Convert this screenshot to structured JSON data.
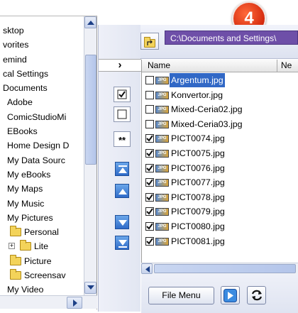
{
  "badge": {
    "number": "4"
  },
  "tree": {
    "items": [
      {
        "label": "sktop",
        "indent": 0,
        "folder": false
      },
      {
        "label": "vorites",
        "indent": 0,
        "folder": false
      },
      {
        "label": "emind",
        "indent": 0,
        "folder": false
      },
      {
        "label": "cal Settings",
        "indent": 0,
        "folder": false
      },
      {
        "label": "Documents",
        "indent": 0,
        "folder": false
      },
      {
        "label": "Adobe",
        "indent": 1,
        "folder": false
      },
      {
        "label": "ComicStudioMi",
        "indent": 1,
        "folder": false
      },
      {
        "label": "EBooks",
        "indent": 1,
        "folder": false
      },
      {
        "label": "Home Design D",
        "indent": 1,
        "folder": false
      },
      {
        "label": "My Data Sourc",
        "indent": 1,
        "folder": false
      },
      {
        "label": "My eBooks",
        "indent": 1,
        "folder": false
      },
      {
        "label": "My Maps",
        "indent": 1,
        "folder": false
      },
      {
        "label": "My Music",
        "indent": 1,
        "folder": false
      },
      {
        "label": "My Pictures",
        "indent": 1,
        "folder": false
      },
      {
        "label": "Personal",
        "indent": 2,
        "folder": true
      },
      {
        "label": "Lite",
        "indent": 2,
        "folder": true,
        "expander": "+"
      },
      {
        "label": "Picture",
        "indent": 2,
        "folder": true
      },
      {
        "label": "Screensav",
        "indent": 2,
        "folder": true
      },
      {
        "label": "My Video",
        "indent": 1,
        "folder": false
      }
    ]
  },
  "toolbar": {
    "expand_label": "›",
    "star_label": "**"
  },
  "path": {
    "value": "C:\\Documents and Settings\\"
  },
  "list": {
    "columns": [
      {
        "label": "Name"
      },
      {
        "label": "Ne"
      }
    ],
    "files": [
      {
        "name": "Argentum.jpg",
        "checked": false,
        "selected": true
      },
      {
        "name": "Konvertor.jpg",
        "checked": false,
        "selected": false
      },
      {
        "name": "Mixed-Ceria02.jpg",
        "checked": false,
        "selected": false
      },
      {
        "name": "Mixed-Ceria03.jpg",
        "checked": false,
        "selected": false
      },
      {
        "name": "PICT0074.jpg",
        "checked": true,
        "selected": false
      },
      {
        "name": "PICT0075.jpg",
        "checked": true,
        "selected": false
      },
      {
        "name": "PICT0076.jpg",
        "checked": true,
        "selected": false
      },
      {
        "name": "PICT0077.jpg",
        "checked": true,
        "selected": false
      },
      {
        "name": "PICT0078.jpg",
        "checked": true,
        "selected": false
      },
      {
        "name": "PICT0079.jpg",
        "checked": true,
        "selected": false
      },
      {
        "name": "PICT0080.jpg",
        "checked": true,
        "selected": false
      },
      {
        "name": "PICT0081.jpg",
        "checked": true,
        "selected": false
      }
    ],
    "icon_text": "JPG"
  },
  "bottom": {
    "file_menu_label": "File Menu"
  },
  "colors": {
    "path_bg": "#6e4fa8",
    "badge": "#d42a0e",
    "selection": "#3168c6"
  }
}
